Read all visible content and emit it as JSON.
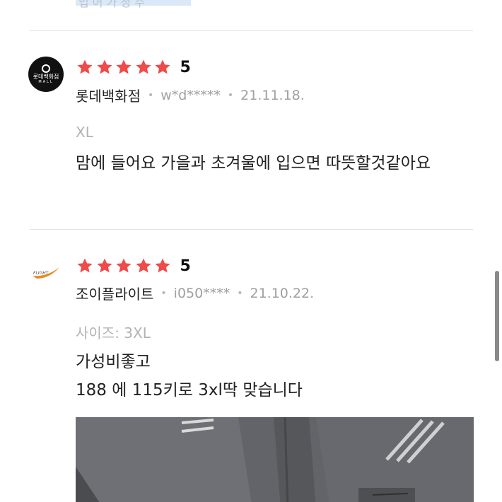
{
  "top_text": "입 어 가 정 주",
  "reviews": [
    {
      "seller": "롯데백화점",
      "seller_logo_text": "롯데백화점",
      "seller_logo_sub": "MALL",
      "score": "5",
      "rating": 5,
      "user": "w*d*****",
      "date": "21.11.18.",
      "option": "XL",
      "text": "맘에 들어요 가을과 초겨울에 입으면 따뜻할것같아요"
    },
    {
      "seller": "조이플라이트",
      "seller_logo_text": "FLIGHT",
      "score": "5",
      "rating": 5,
      "user": "i050****",
      "date": "21.10.22.",
      "option": "사이즈: 3XL",
      "text_lines": [
        "가성비좋고",
        "188 에 115키로 3xl딱 맞습니다"
      ]
    }
  ],
  "meta_separator": "•",
  "colors": {
    "star": "#ef4b4b",
    "divider": "#e3e3e3",
    "muted": "#a0a0a0"
  }
}
